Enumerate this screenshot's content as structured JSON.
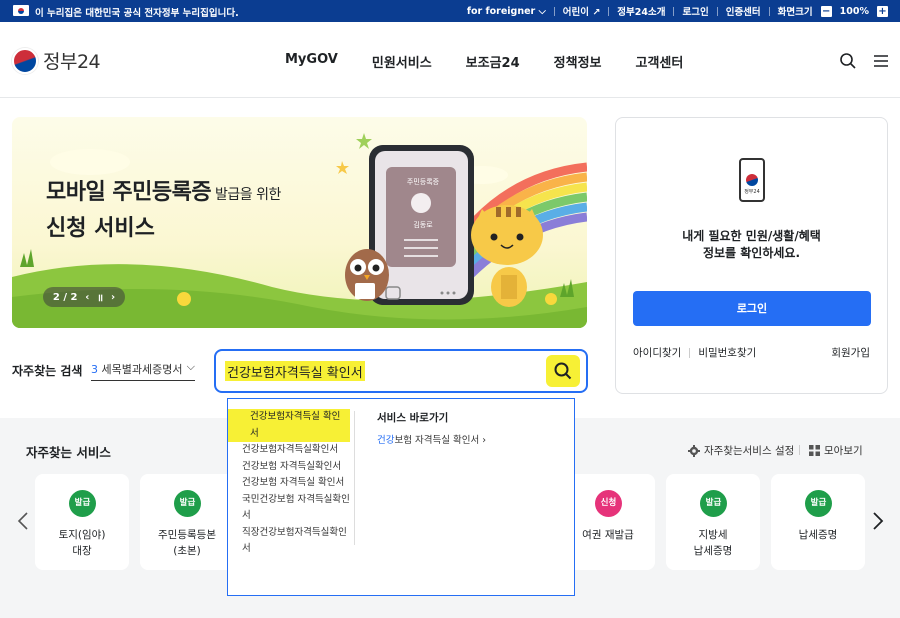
{
  "topbar": {
    "notice": "이 누리집은 대한민국 공식 전자정부 누리집입니다.",
    "for_foreigner": "for foreigner",
    "kids": "어린이",
    "about": "정부24소개",
    "login": "로그인",
    "cert": "인증센터",
    "zoom_label": "화면크기",
    "zoom_value": "100%",
    "minus": "−",
    "plus": "+"
  },
  "header": {
    "logo_text": "정부24",
    "nav": [
      "MyGOV",
      "민원서비스",
      "보조금24",
      "정책정보",
      "고객센터"
    ]
  },
  "banner": {
    "title_main": "모바일 주민등록증",
    "title_small": " 발급을 위한",
    "title_line2": "신청 서비스",
    "pager": "2 / 2",
    "phone_card_title": "주민등록증",
    "phone_card_name": "김동로"
  },
  "login_card": {
    "phone_logo": "정부24",
    "message_line1": "내게 필요한 민원/생활/혜택",
    "message_line2": "정보를 확인하세요.",
    "login_button": "로그인",
    "find_id": "아이디찾기",
    "find_pw": "비밀번호찾기",
    "join": "회원가입"
  },
  "search": {
    "label": "자주찾는 검색",
    "popular_num": "3",
    "popular_text": "세목별과세증명서",
    "query": "건강보험자격득실 확인서"
  },
  "autocomplete": {
    "items": [
      "건강보험자격득실 확인서",
      "건강보험자격득실확인서",
      "건강보험 자격득실확인서",
      "건강보험 자격득실 확인서",
      "국민건강보험 자격득실확인서",
      "직장건강보험자격득실확인서"
    ],
    "shortcut_title": "서비스 바로가기",
    "shortcut_blue": "건강",
    "shortcut_rest": "보험 자격득실 확인서",
    "shortcut_arrow": "›"
  },
  "services": {
    "title": "자주찾는 서비스",
    "settings": "자주찾는서비스 설정",
    "view_all": "모아보기",
    "cards": [
      {
        "badge": "발급",
        "line1": "토지(임야)",
        "line2": "대장",
        "badge_color": "#1f9e4a"
      },
      {
        "badge": "발급",
        "line1": "주민등록등본",
        "line2": "(초본)",
        "badge_color": "#1f9e4a"
      },
      {
        "badge": "신청",
        "line1": "여권 재발급",
        "line2": "",
        "badge_color": "#e6337a"
      },
      {
        "badge": "발급",
        "line1": "지방세",
        "line2": "납세증명",
        "badge_color": "#1f9e4a"
      },
      {
        "badge": "발급",
        "line1": "납세증명",
        "line2": "",
        "badge_color": "#1f9e4a"
      }
    ]
  },
  "colors": {
    "brand_navy": "#0b3d91",
    "primary_blue": "#256ef4",
    "highlight": "#f7f035"
  }
}
